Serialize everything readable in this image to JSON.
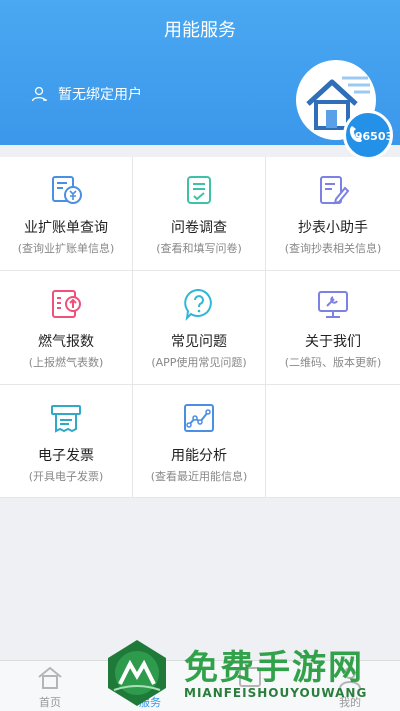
{
  "header": {
    "title": "用能服务",
    "user_label": "暂无绑定用户",
    "phone_number": "96503"
  },
  "services": [
    {
      "title": "业扩账单查询",
      "subtitle": "(查询业扩账单信息)",
      "icon": "bill-yuan-icon",
      "color": "#4a8fe2"
    },
    {
      "title": "问卷调查",
      "subtitle": "(查看和填写问卷)",
      "icon": "questionnaire-check-icon",
      "color": "#3fc1a9"
    },
    {
      "title": "抄表小助手",
      "subtitle": "(查询抄表相关信息)",
      "icon": "meter-edit-icon",
      "color": "#7b82e3"
    },
    {
      "title": "燃气报数",
      "subtitle": "(上报燃气表数)",
      "icon": "gas-upload-icon",
      "color": "#f0517a"
    },
    {
      "title": "常见问题",
      "subtitle": "(APP使用常见问题)",
      "icon": "question-bubble-icon",
      "color": "#2fb6d8"
    },
    {
      "title": "关于我们",
      "subtitle": "(二维码、版本更新)",
      "icon": "monitor-wrench-icon",
      "color": "#7b82e3"
    },
    {
      "title": "电子发票",
      "subtitle": "(开具电子发票)",
      "icon": "invoice-print-icon",
      "color": "#2fa8c9"
    },
    {
      "title": "用能分析",
      "subtitle": "(查看最近用能信息)",
      "icon": "analysis-chart-icon",
      "color": "#4a8fe2"
    }
  ],
  "tabbar": [
    {
      "label": "首页",
      "icon": "home-icon",
      "active": false
    },
    {
      "label": "服务",
      "icon": "service-icon",
      "active": true
    },
    {
      "label": "",
      "icon": "news-icon",
      "active": false
    },
    {
      "label": "我的",
      "icon": "profile-icon",
      "active": false
    }
  ],
  "watermark": {
    "title": "免费手游网",
    "subtitle": "MIANFEISHOUYOUWANG"
  }
}
